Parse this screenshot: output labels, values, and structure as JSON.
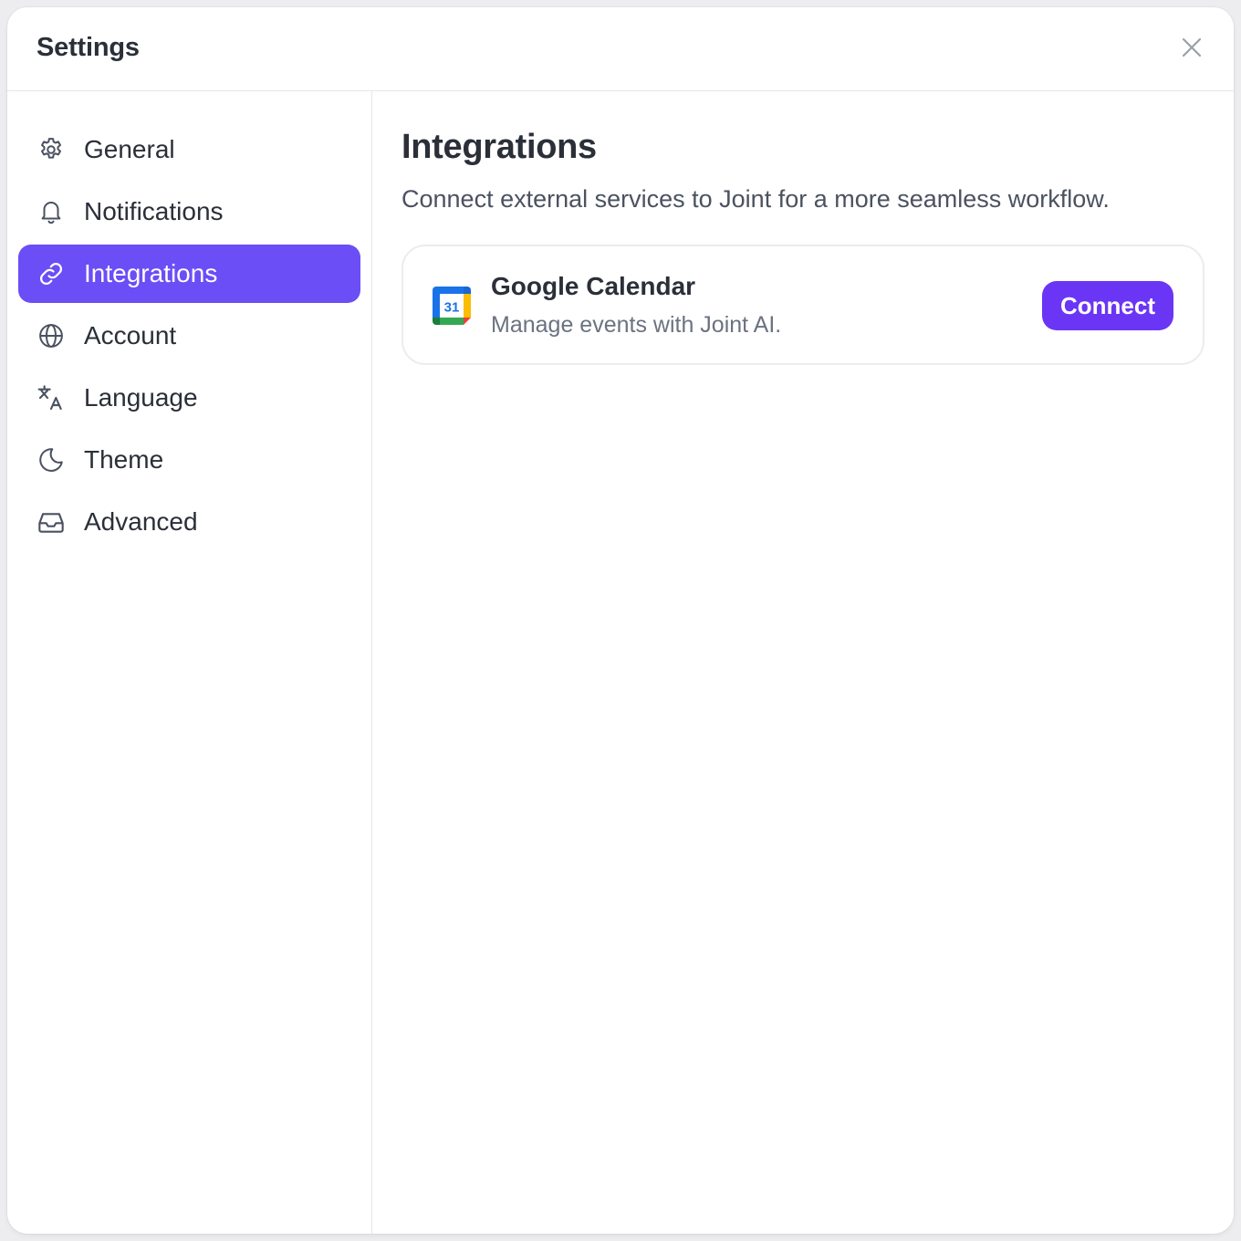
{
  "header": {
    "title": "Settings"
  },
  "sidebar": {
    "items": [
      {
        "label": "General",
        "icon": "gear-icon"
      },
      {
        "label": "Notifications",
        "icon": "bell-icon"
      },
      {
        "label": "Integrations",
        "icon": "link-icon",
        "active": true
      },
      {
        "label": "Account",
        "icon": "globe-icon"
      },
      {
        "label": "Language",
        "icon": "translate-icon"
      },
      {
        "label": "Theme",
        "icon": "moon-icon"
      },
      {
        "label": "Advanced",
        "icon": "inbox-icon"
      }
    ]
  },
  "main": {
    "title": "Integrations",
    "description": "Connect external services to Joint for a more seamless workflow.",
    "integrations": [
      {
        "name": "Google Calendar",
        "description": "Manage events with Joint AI.",
        "button_label": "Connect",
        "logo": "google-calendar-icon",
        "logo_text": "31"
      }
    ]
  },
  "colors": {
    "accent": "#6b4ef5",
    "button": "#6b35f5",
    "text": "#2a2f38",
    "muted": "#6b7280"
  }
}
